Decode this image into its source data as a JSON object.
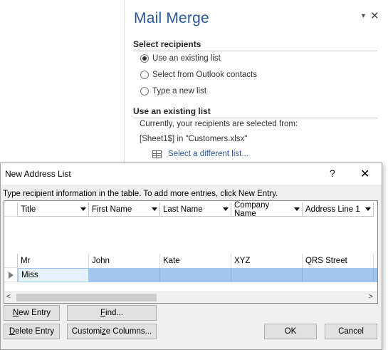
{
  "task_pane": {
    "title": "Mail Merge",
    "menu_glyph": "▼",
    "close_glyph": "✕",
    "select_recipients_header": "Select recipients",
    "options": [
      {
        "label": "Use an existing list",
        "checked": true
      },
      {
        "label": "Select from Outlook contacts",
        "checked": false
      },
      {
        "label": "Type a new list",
        "checked": false
      }
    ],
    "use_existing_header": "Use an existing list",
    "currently_text": "Currently, your recipients are selected from:",
    "source_text": "[Sheet1$] in \"Customers.xlsx\"",
    "select_different_link": "Select a different list..."
  },
  "dialog": {
    "title": "New Address List",
    "help_glyph": "?",
    "close_glyph": "✕",
    "instructions": "Type recipient information in the table.  To add more entries, click New Entry.",
    "columns": [
      "Title",
      "First Name",
      "Last Name",
      "Company Name",
      "Address Line 1"
    ],
    "rows": [
      {
        "title": "Mr",
        "first_name": "John",
        "last_name": "Kate",
        "company": "XYZ",
        "address1": "QRS Street"
      },
      {
        "title": "Miss",
        "first_name": "",
        "last_name": "",
        "company": "",
        "address1": ""
      }
    ],
    "scroll_left_glyph": "<",
    "scroll_right_glyph": ">",
    "buttons": {
      "new_entry": {
        "underlined": "N",
        "rest": "ew Entry"
      },
      "find": {
        "underlined": "F",
        "rest": "ind..."
      },
      "delete_entry": {
        "underlined": "D",
        "rest": "elete Entry"
      },
      "customize_columns": {
        "pre": "Customi",
        "underlined": "z",
        "rest": "e Columns..."
      },
      "ok": "OK",
      "cancel": "Cancel"
    }
  },
  "colors": {
    "accent": "#2b579a",
    "selection": "#9fc7ed",
    "active_cell": "#e5f1fb"
  }
}
